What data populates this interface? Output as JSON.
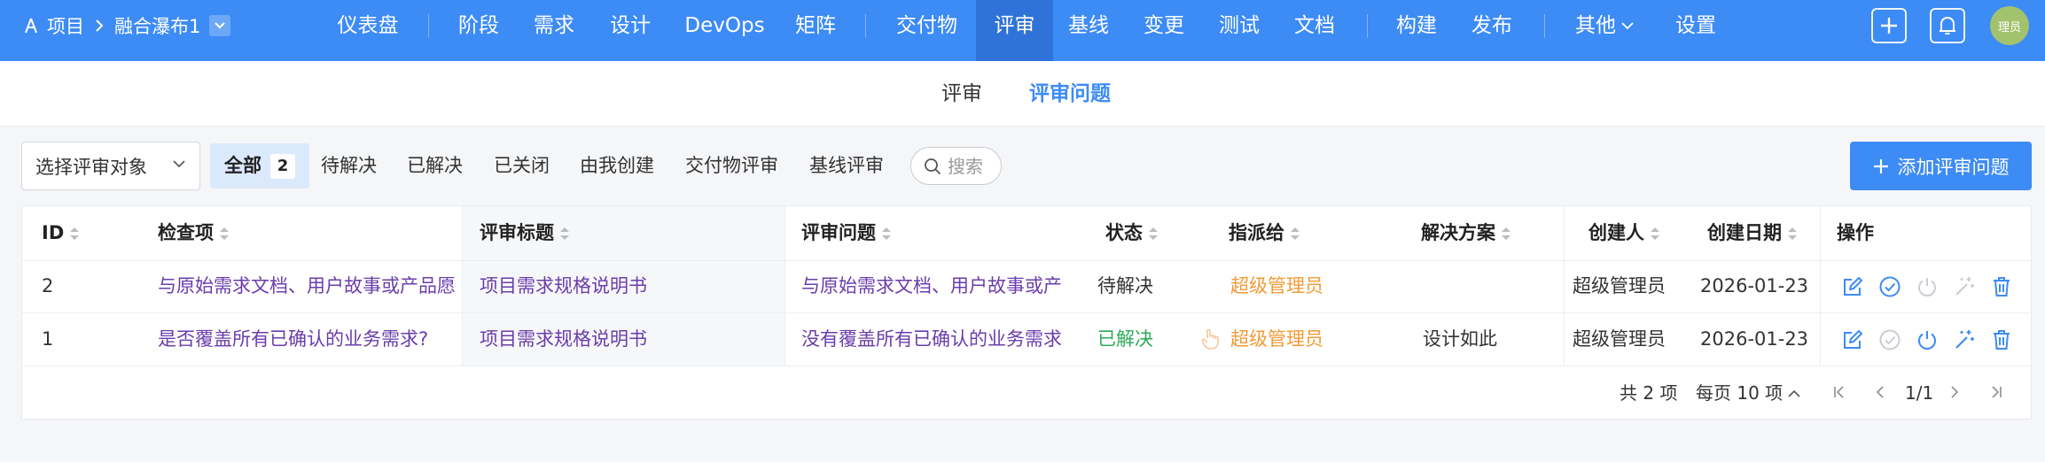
{
  "project": {
    "label": "项目",
    "name": "融合瀑布1"
  },
  "nav": [
    {
      "label": "仪表盘",
      "active": false
    },
    {
      "label": "阶段",
      "active": false
    },
    {
      "label": "需求",
      "active": false
    },
    {
      "label": "设计",
      "active": false
    },
    {
      "label": "DevOps",
      "active": false
    },
    {
      "label": "矩阵",
      "active": false
    },
    {
      "label": "交付物",
      "active": false
    },
    {
      "label": "评审",
      "active": true
    },
    {
      "label": "基线",
      "active": false
    },
    {
      "label": "变更",
      "active": false
    },
    {
      "label": "测试",
      "active": false
    },
    {
      "label": "文档",
      "active": false
    },
    {
      "label": "构建",
      "active": false
    },
    {
      "label": "发布",
      "active": false
    },
    {
      "label": "其他",
      "active": false
    },
    {
      "label": "设置",
      "active": false
    }
  ],
  "user": {
    "avatar_text": "理员"
  },
  "subtabs": [
    {
      "label": "评审",
      "active": false
    },
    {
      "label": "评审问题",
      "active": true
    }
  ],
  "filter": {
    "select_placeholder": "选择评审对象",
    "tabs": [
      {
        "label": "全部",
        "count": "2",
        "active": true
      },
      {
        "label": "待解决"
      },
      {
        "label": "已解决"
      },
      {
        "label": "已关闭"
      },
      {
        "label": "由我创建"
      },
      {
        "label": "交付物评审"
      },
      {
        "label": "基线评审"
      }
    ],
    "search_placeholder": "搜索",
    "add_button": "添加评审问题"
  },
  "table": {
    "columns": [
      "ID",
      "检查项",
      "评审标题",
      "评审问题",
      "状态",
      "指派给",
      "解决方案",
      "创建人",
      "创建日期",
      "操作"
    ],
    "rows": [
      {
        "id": "2",
        "check_item": "与原始需求文档、用户故事或产品愿",
        "review_title": "项目需求规格说明书",
        "issue": "与原始需求文档、用户故事或产",
        "status": "待解决",
        "assignee": "超级管理员",
        "solution": "",
        "creator": "超级管理员",
        "created": "2026-01-23"
      },
      {
        "id": "1",
        "check_item": "是否覆盖所有已确认的业务需求?",
        "review_title": "项目需求规格说明书",
        "issue": "没有覆盖所有已确认的业务需求",
        "status": "已解决",
        "assignee": "超级管理员",
        "solution": "设计如此",
        "creator": "超级管理员",
        "created": "2026-01-23"
      }
    ]
  },
  "pagination": {
    "total": "共 2 项",
    "per_page": "每页 10 项",
    "current": "1/1"
  },
  "colors": {
    "primary": "#3d8bf5",
    "nav_active": "#2f72d8",
    "link": "#6a3dab",
    "solved": "#2dab58",
    "assignee": "#f39a36"
  }
}
